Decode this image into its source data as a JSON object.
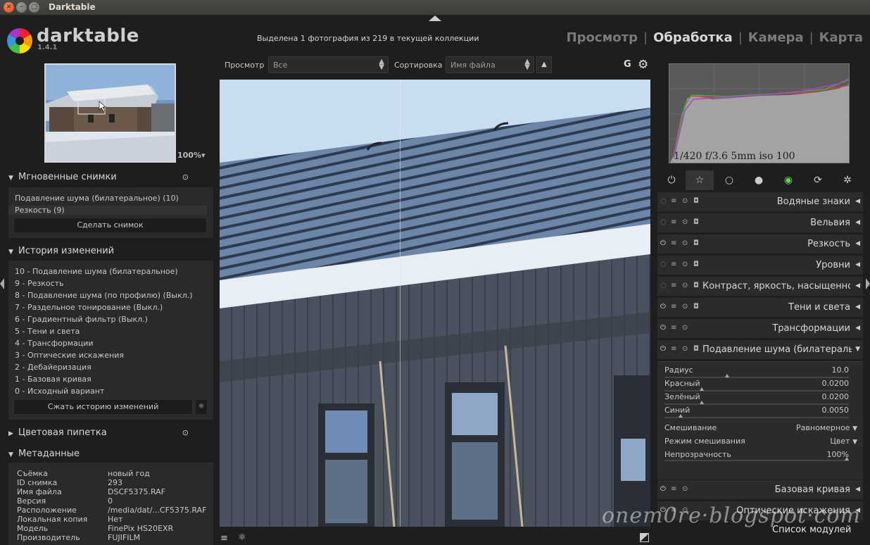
{
  "window": {
    "title": "Darktable"
  },
  "header": {
    "app_name": "darktable",
    "version": "1.4.1",
    "selection_info": "Выделена 1 фотография из 219 в текущей коллекции",
    "views": [
      "Просмотр",
      "Обработка",
      "Камера",
      "Карта"
    ],
    "active_view": "Обработка",
    "separator": "|"
  },
  "filter_bar": {
    "view_label": "Просмотр",
    "view_value": "Все",
    "sort_label": "Сортировка",
    "sort_value": "Имя файла",
    "g_label": "G"
  },
  "navigation": {
    "zoom": "100%▾"
  },
  "snapshots": {
    "title": "Мгновенные снимки",
    "items": [
      "Подавление шума (билатеральное) (10)",
      "Резкость (9)"
    ],
    "take_button": "Сделать снимок"
  },
  "history": {
    "title": "История изменений",
    "items": [
      "10 - Подавление шума (билатеральное)",
      "9 - Резкость",
      "8 - Подавление шума (по профилю)   (Выкл.)",
      "7 - Раздельное тонирование   (Выкл.)",
      "6 - Градиентный фильтр   (Выкл.)",
      "5 - Тени и света",
      "4 - Трансформации",
      "3 - Оптические искажения",
      "2 - Дебайеризация",
      "1 - Базовая кривая",
      "0 - Исходный вариант"
    ],
    "compress_button": "Сжать историю изменений"
  },
  "color_picker": {
    "title": "Цветовая пипетка"
  },
  "metadata": {
    "title": "Метаданные",
    "rows": [
      {
        "key": "Съёмка",
        "value": "новый год"
      },
      {
        "key": "ID снимка",
        "value": "293"
      },
      {
        "key": "Имя файла",
        "value": "DSCF5375.RAF"
      },
      {
        "key": "Версия",
        "value": "0"
      },
      {
        "key": "Расположение",
        "value": "/media/dat/...CF5375.RAF"
      },
      {
        "key": "Локальная копия",
        "value": "Нет"
      },
      {
        "key": "Модель",
        "value": "FinePix HS20EXR"
      },
      {
        "key": "Производитель",
        "value": "FUJIFILM"
      }
    ]
  },
  "histogram": {
    "exif": "1/420 f/3.6 5mm iso 100"
  },
  "modules": [
    "Водяные знаки",
    "Вельвия",
    "Резкость",
    "Уровни",
    "Контраст, яркость, насыщенность",
    "Тени и света",
    "Трансформации",
    "Подавление шума (билатеральное)",
    "Базовая кривая",
    "Оптические искажения"
  ],
  "denoise_params": {
    "radius_label": "Радиус",
    "radius_value": "10.0",
    "red_label": "Красный",
    "red_value": "0.0200",
    "green_label": "Зелёный",
    "green_value": "0.0200",
    "blue_label": "Синий",
    "blue_value": "0.0050",
    "blend_label": "Смешивание",
    "blend_value": "Равномерное",
    "blend_mode_label": "Режим смешивания",
    "blend_mode_value": "Цвет",
    "opacity_label": "Непрозрачность",
    "opacity_value": "100%"
  },
  "module_list_label": "Список модулей",
  "watermark": "onem0re·blogspot·com"
}
